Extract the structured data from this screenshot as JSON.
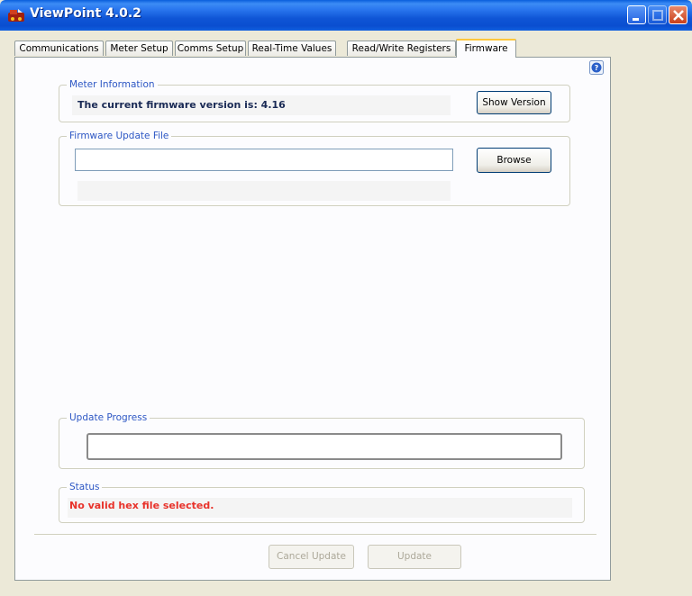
{
  "window": {
    "title": "ViewPoint 4.0.2",
    "icon": "viewpoint-app-icon",
    "controls": [
      "minimize-icon",
      "maximize-icon",
      "close-icon"
    ]
  },
  "tabs": [
    {
      "label": "Communications",
      "active": false
    },
    {
      "label": "Meter Setup",
      "active": false
    },
    {
      "label": "Comms Setup",
      "active": false
    },
    {
      "label": "Real-Time Values",
      "active": false
    },
    {
      "label": "Read/Write Registers",
      "active": false
    },
    {
      "label": "Firmware",
      "active": true
    }
  ],
  "help_icon": "help-icon",
  "meter_info": {
    "legend": "Meter Information",
    "firmware_text": "The current firmware version is: 4.16",
    "show_version_label": "Show Version"
  },
  "firmware_file": {
    "legend": "Firmware Update File",
    "file_path": "",
    "browse_label": "Browse"
  },
  "update_progress": {
    "legend": "Update Progress",
    "progress_percent": 0
  },
  "status": {
    "legend": "Status",
    "message": "No valid hex file selected.",
    "message_color": "#e8322a"
  },
  "actions": {
    "cancel_label": "Cancel Update",
    "update_label": "Update"
  },
  "colors": {
    "legend": "#2d57c4",
    "titlebar": "#0a4ed0",
    "active_tab_accent": "#ffc73c"
  }
}
